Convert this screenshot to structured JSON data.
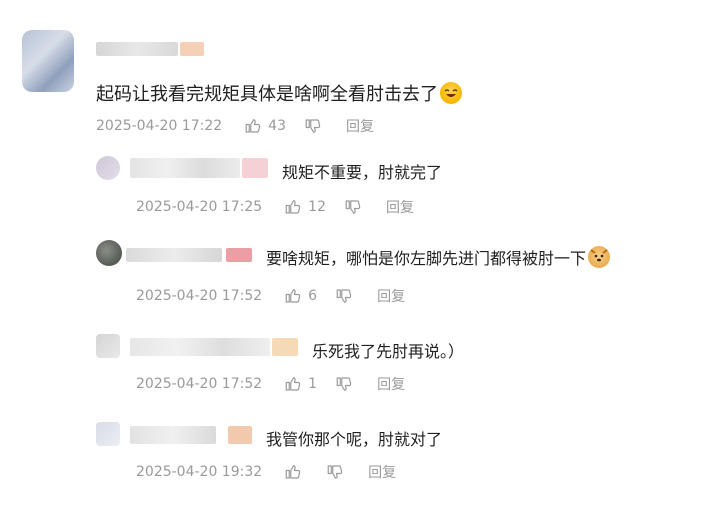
{
  "comment": {
    "text": "起码让我看完规矩具体是啥啊全看肘击去了",
    "time": "2025-04-20 17:22",
    "likes": "43",
    "reply_label": "回复"
  },
  "replies": [
    {
      "text": "规矩不重要，肘就完了",
      "time": "2025-04-20 17:25",
      "likes": "12",
      "reply_label": "回复"
    },
    {
      "text": "要啥规矩，哪怕是你左脚先进门都得被肘一下",
      "time": "2025-04-20 17:52",
      "likes": "6",
      "reply_label": "回复"
    },
    {
      "text": "乐死我了先肘再说。）",
      "time": "2025-04-20 17:52",
      "likes": "1",
      "reply_label": "回复"
    },
    {
      "text": "我管你那个呢，肘就对了",
      "time": "2025-04-20 19:32",
      "likes": "",
      "reply_label": "回复"
    }
  ],
  "icons": {
    "like": "thumbs-up-icon",
    "dislike": "thumbs-down-icon",
    "emoji_laugh": "laughing-emoji-icon",
    "emoji_dog": "dog-emoji-icon"
  },
  "colors": {
    "meta_text": "#9a9a9a",
    "body_text": "#1f1f1f",
    "blur_badge": "#f2c3a4"
  }
}
